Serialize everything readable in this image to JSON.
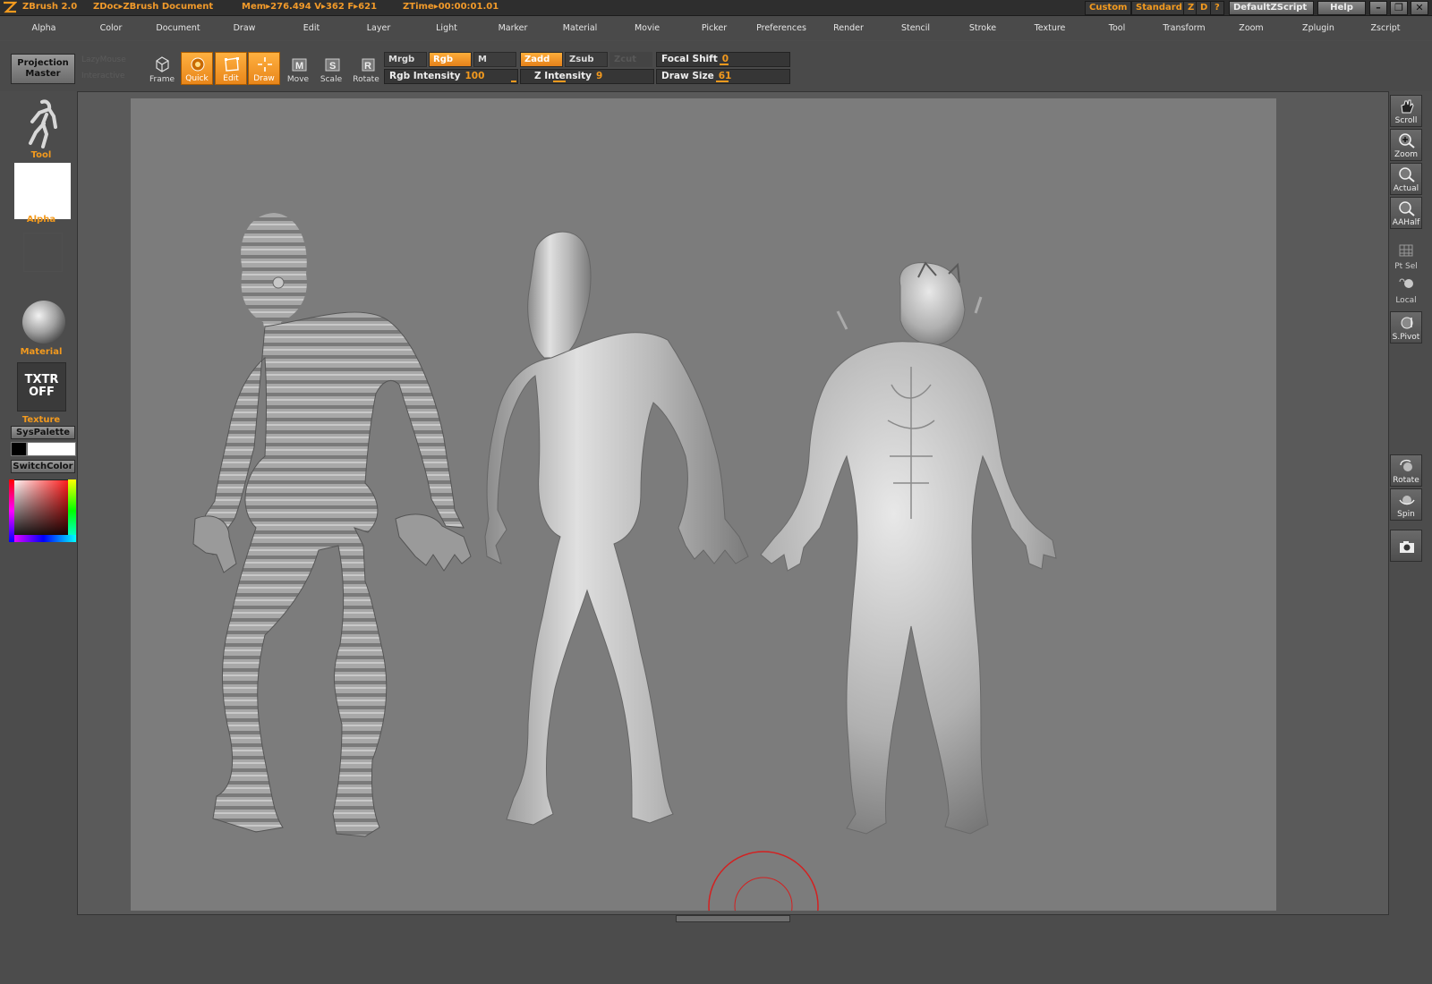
{
  "titlebar": {
    "app": "ZBrush 2.0",
    "doc": "ZDoc▸ZBrush Document",
    "mem": "Mem▸276.494 V▸362 F▸621",
    "ztime": "ZTime▸00:00:01.01",
    "custom": "Custom",
    "standard": "Standard",
    "z": "Z",
    "d": "D",
    "q": "?",
    "script": "DefaultZScript",
    "help": "Help"
  },
  "menu": [
    "Alpha",
    "Color",
    "Document",
    "Draw",
    "Edit",
    "Layer",
    "Light",
    "Marker",
    "Material",
    "Movie",
    "Picker",
    "Preferences",
    "Render",
    "Stencil",
    "Stroke",
    "Texture",
    "Tool",
    "Transform",
    "Zoom",
    "Zplugin",
    "Zscript"
  ],
  "toolbar": {
    "projection_master": "Projection Master",
    "ghost_lc": "LazyMouse",
    "ghost_ic": "Interactive",
    "frame": "Frame",
    "quick": "Quick",
    "edit": "Edit",
    "draw": "Draw",
    "move": "Move",
    "scale": "Scale",
    "rotate": "Rotate",
    "mrgb": "Mrgb",
    "rgb": "Rgb",
    "m": "M",
    "zadd": "Zadd",
    "zsub": "Zsub",
    "zcut": "Zcut",
    "rgb_intensity_label": "Rgb  Intensity",
    "rgb_intensity": "100",
    "z_intensity_label": "Z  Intensity",
    "z_intensity": "9",
    "focal_shift_label": "Focal  Shift",
    "focal_shift": "0",
    "draw_size_label": "Draw  Size",
    "draw_size": "61"
  },
  "leftshelf": {
    "tool": "Tool",
    "alpha": "Alpha",
    "material": "Material",
    "txtr": "TXTR OFF",
    "texture": "Texture",
    "syspalette": "SysPalette",
    "switchcolor": "SwitchColor"
  },
  "rightshelf": [
    "Scroll",
    "Zoom",
    "Actual",
    "AAHalf",
    "Pt Sel",
    "Local",
    "S.Pivot",
    "Rotate",
    "Spin"
  ],
  "colors": {
    "accent": "#f39a1e",
    "canvas": "#7c7c7c",
    "brush_ring": "#d42020"
  }
}
